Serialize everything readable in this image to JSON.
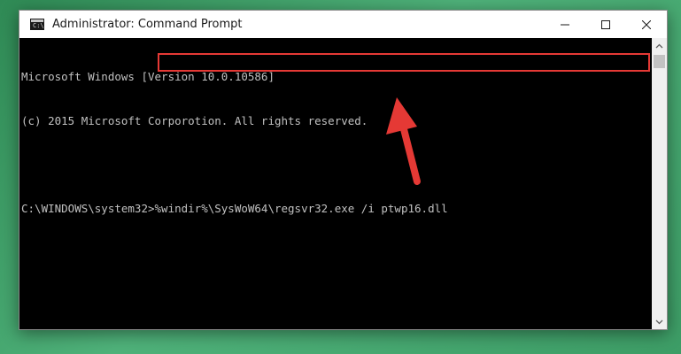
{
  "window": {
    "title": "Administrator: Command Prompt",
    "app_icon_glyph": "C:\\"
  },
  "console": {
    "lines": [
      "Microsoft Windows [Version 10.0.10586]",
      "(c) 2015 Microsoft Corporotion. All rights reserved.",
      "",
      "C:\\WINDOWS\\system32>%windir%\\SysWoW64\\regsvr32.exe /i ptwp16.dll"
    ]
  },
  "icons": {
    "minimize": "minimize-icon",
    "maximize": "maximize-icon",
    "close": "close-icon",
    "annotation": "red-arrow-icon"
  },
  "colors": {
    "highlight": "#e53935",
    "arrow": "#e53935",
    "console_text": "#c0c0c0",
    "background": "#3d9d66"
  }
}
